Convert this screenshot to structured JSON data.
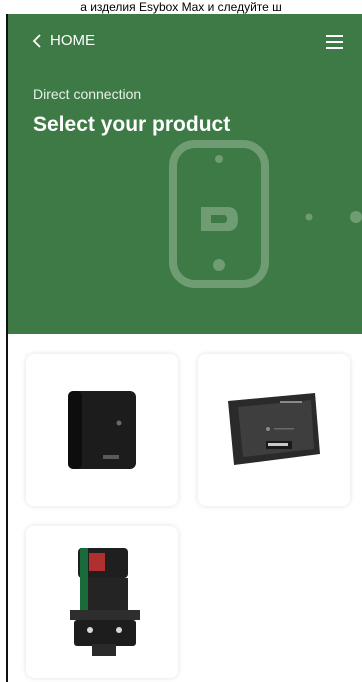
{
  "caption": "a изделия Esybox Max и следуйте ш",
  "header": {
    "back_label": "HOME",
    "subtitle": "Direct connection",
    "title": "Select your product"
  },
  "products": [
    {
      "icon": "esybox-mini-product-image"
    },
    {
      "icon": "dconnect-box-product-image"
    },
    {
      "icon": "esybox-max-pump-product-image"
    }
  ],
  "colors": {
    "header_green": "#3d7a45",
    "text_white": "#ffffff",
    "card_bg": "#ffffff"
  }
}
